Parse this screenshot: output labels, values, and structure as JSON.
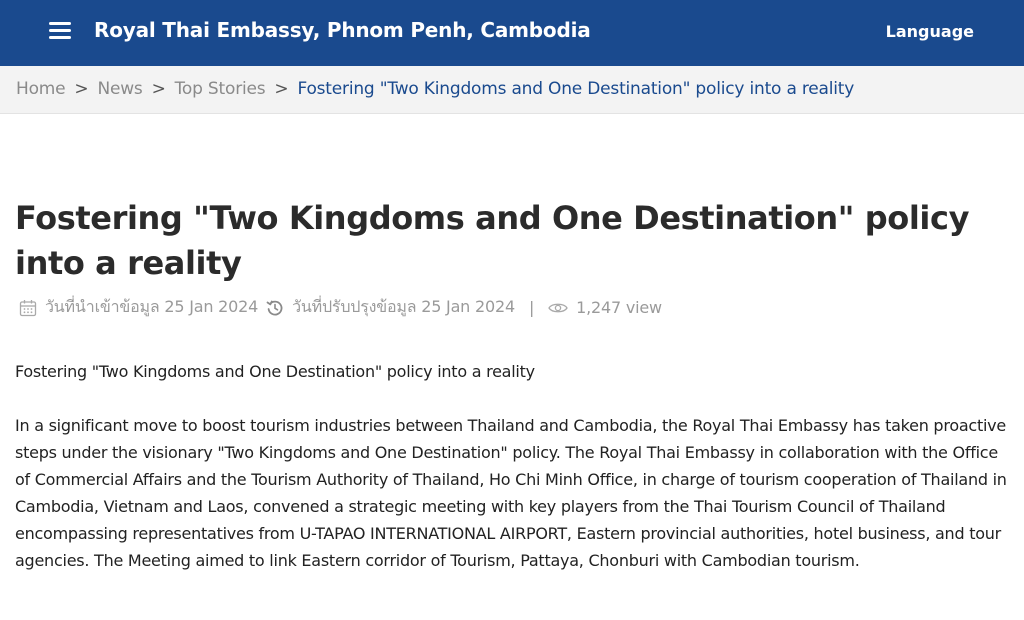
{
  "header": {
    "site_title": "Royal Thai Embassy, Phnom Penh, Cambodia",
    "language_label": "Language",
    "menu_icon": "hamburger-menu-icon"
  },
  "breadcrumb": {
    "items": [
      "Home",
      "News",
      "Top Stories"
    ],
    "separator": ">",
    "current": "Fostering \"Two Kingdoms and One Destination\" policy into a reality"
  },
  "article": {
    "title": "Fostering \"Two Kingdoms and One Destination\" policy into a reality",
    "meta": {
      "created_label": "วันที่นำเข้าข้อมูล 25 Jan 2024",
      "updated_label": "วันที่ปรับปรุงข้อมูล 25 Jan 2024",
      "separator": "|",
      "views": "1,247 view",
      "icons": [
        "calendar-icon",
        "history-icon",
        "eye-icon"
      ]
    },
    "paragraphs": [
      "Fostering \"Two Kingdoms and One Destination\" policy into a reality",
      "In a significant move to boost tourism industries between Thailand and Cambodia, the Royal Thai Embassy has taken proactive steps under the visionary \"Two Kingdoms and One Destination\" policy. The Royal Thai Embassy in collaboration with the Office of Commercial Affairs and the Tourism Authority of Thailand, Ho Chi Minh Office, in charge of tourism cooperation of Thailand in Cambodia, Vietnam and Laos, convened a strategic meeting with key players from the Thai Tourism Council of Thailand encompassing representatives from U-TAPAO INTERNATIONAL AIRPORT, Eastern provincial authorities, hotel business, and tour agencies. The Meeting aimed to link Eastern corridor of Tourism, Pattaya, Chonburi with Cambodian tourism."
    ]
  },
  "colors": {
    "header_bg": "#1a4a8e",
    "breadcrumb_bg": "#f3f3f3",
    "link_active": "#1a4a8e",
    "muted_text": "#9a9a9a"
  }
}
